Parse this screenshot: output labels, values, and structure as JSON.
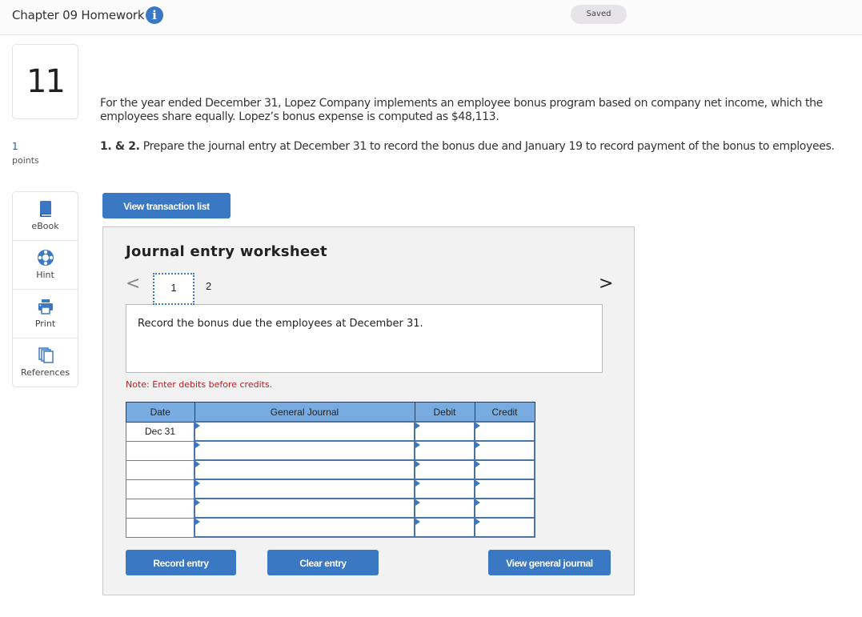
{
  "header": {
    "title": "Chapter 09 Homework",
    "info_icon": "info-icon",
    "status": "Saved"
  },
  "question": {
    "number": "11",
    "points_value": "1",
    "points_label": "points"
  },
  "tools": [
    {
      "label": "eBook",
      "icon": "book-icon"
    },
    {
      "label": "Hint",
      "icon": "lifebuoy-icon"
    },
    {
      "label": "Print",
      "icon": "printer-icon"
    },
    {
      "label": "References",
      "icon": "documents-icon"
    }
  ],
  "problem": {
    "intro": "For the year ended December 31, Lopez Company implements an employee bonus program based on company net income, which the employees share equally. Lopez’s bonus expense is computed as $48,113.",
    "task_bold": "1. & 2.",
    "task_text": " Prepare the journal entry at December 31 to record the bonus due and January 19 to record payment of the bonus to employees."
  },
  "buttons": {
    "view_transaction_list": "View transaction list",
    "record_entry": "Record entry",
    "clear_entry": "Clear entry",
    "view_general_journal": "View general journal"
  },
  "worksheet": {
    "title": "Journal entry worksheet",
    "prev": "<",
    "next": ">",
    "tabs": [
      "1",
      "2"
    ],
    "active_tab": "1",
    "prompt": "Record the bonus due the employees at December 31.",
    "note": "Note: Enter debits before credits.",
    "columns": [
      "Date",
      "General Journal",
      "Debit",
      "Credit"
    ],
    "rows": [
      {
        "date": "Dec 31",
        "account": "",
        "debit": "",
        "credit": ""
      },
      {
        "date": "",
        "account": "",
        "debit": "",
        "credit": ""
      },
      {
        "date": "",
        "account": "",
        "debit": "",
        "credit": ""
      },
      {
        "date": "",
        "account": "",
        "debit": "",
        "credit": ""
      },
      {
        "date": "",
        "account": "",
        "debit": "",
        "credit": ""
      },
      {
        "date": "",
        "account": "",
        "debit": "",
        "credit": ""
      }
    ]
  },
  "colors": {
    "accent": "#3b78c3",
    "table_header": "#78ace0",
    "note": "#b22222"
  }
}
